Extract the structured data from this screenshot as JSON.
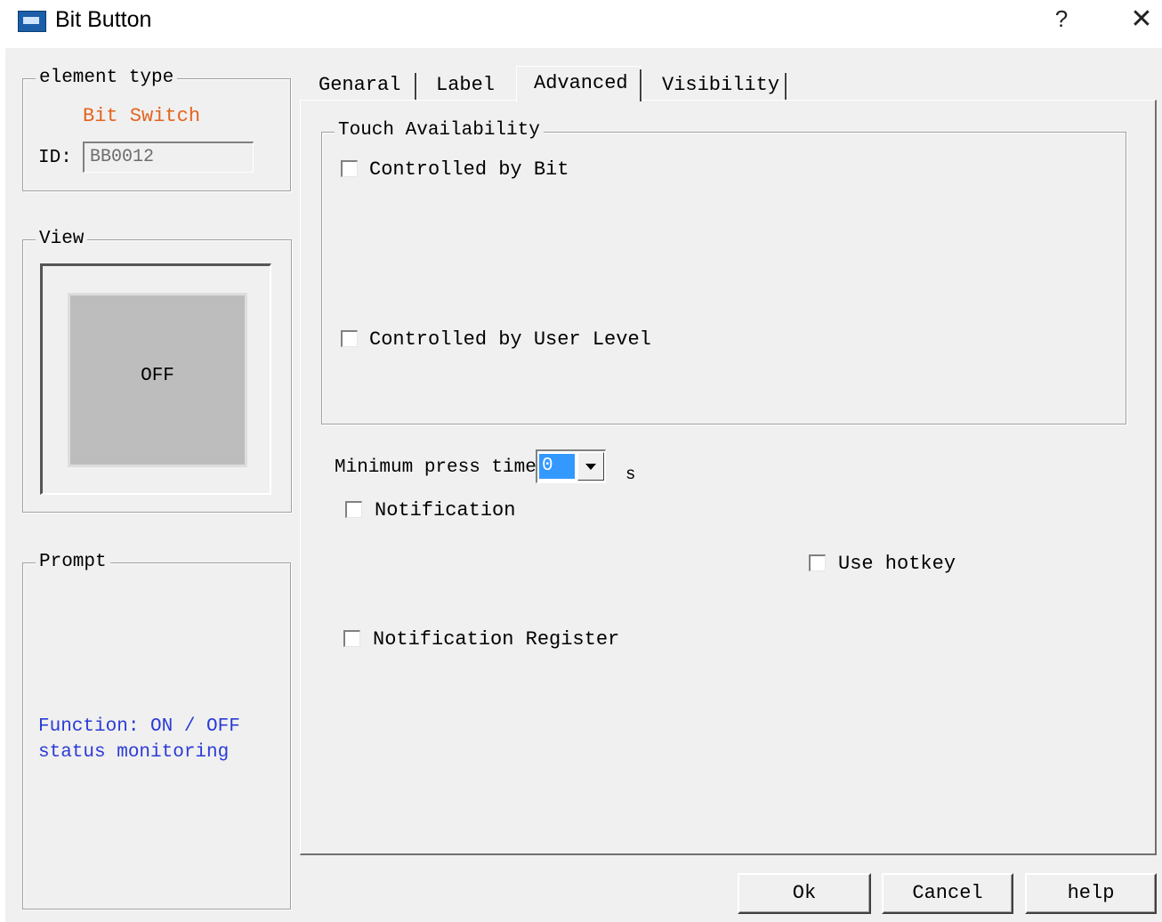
{
  "window": {
    "title": "Bit Button",
    "help_glyph": "?",
    "close_glyph": "✕"
  },
  "element_type": {
    "legend": "element type",
    "type_name": "Bit Switch",
    "id_label": "ID:",
    "id_value": "BB0012"
  },
  "view": {
    "legend": "View",
    "preview_text": "OFF"
  },
  "prompt": {
    "legend": "Prompt",
    "line1": "Function: ON / OFF",
    "line2": "status monitoring"
  },
  "tabs": [
    {
      "label": "Genaral",
      "active": false
    },
    {
      "label": "Label",
      "active": false
    },
    {
      "label": "Advanced",
      "active": true
    },
    {
      "label": "Visibility",
      "active": false
    }
  ],
  "advanced": {
    "touch_legend": "Touch Availability",
    "controlled_by_bit": {
      "label": "Controlled by Bit",
      "checked": false
    },
    "controlled_by_user_level": {
      "label": "Controlled by User Level",
      "checked": false
    },
    "min_press_label": "Minimum press time:",
    "min_press_value": "0",
    "min_press_unit": "s",
    "notification": {
      "label": "Notification",
      "checked": false
    },
    "use_hotkey": {
      "label": "Use hotkey",
      "checked": false
    },
    "notification_register": {
      "label": "Notification Register",
      "checked": false
    }
  },
  "buttons": {
    "ok": "Ok",
    "cancel": "Cancel",
    "help": "help"
  },
  "colors": {
    "type_name": "#e4631e",
    "prompt_text": "#2b3bd6",
    "selection": "#3399ff"
  }
}
